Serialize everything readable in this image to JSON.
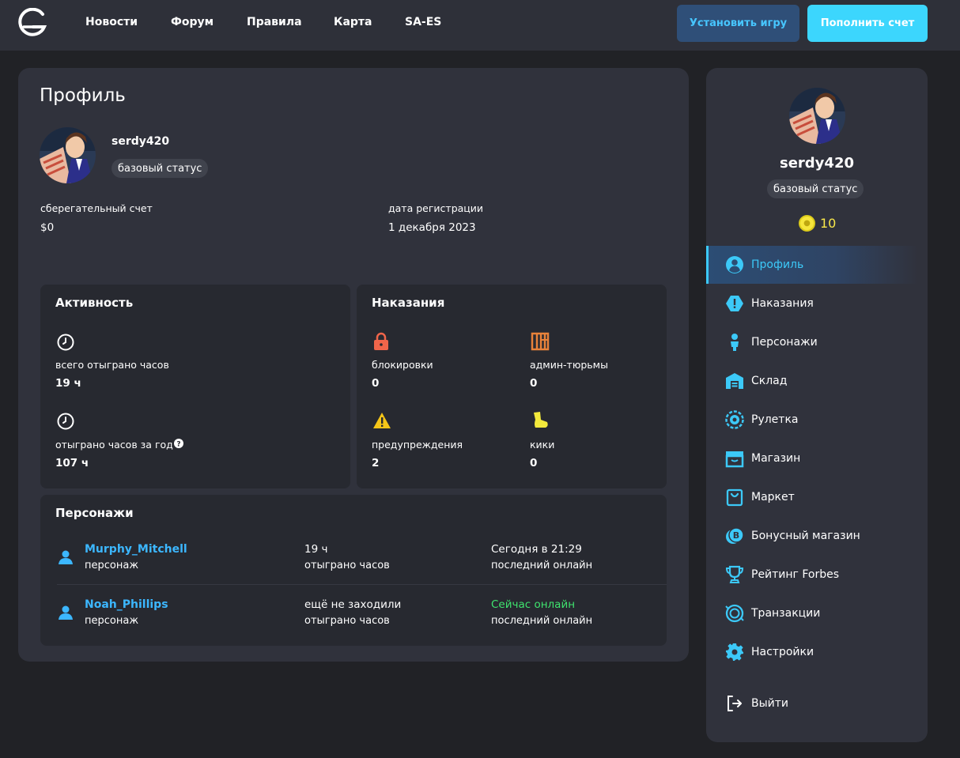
{
  "header": {
    "nav": [
      "Новости",
      "Форум",
      "Правила",
      "Карта",
      "SA-ES"
    ],
    "install_button": "Установить игру",
    "topup_button": "Пополнить счет"
  },
  "profile": {
    "title": "Профиль",
    "username": "serdy420",
    "status": "базовый статус",
    "savings_label": "сберегательный счет",
    "savings_value": "$0",
    "reg_label": "дата регистрации",
    "reg_value": "1 декабря 2023"
  },
  "activity": {
    "title": "Активность",
    "total_label": "всего отыграно часов",
    "total_value": "19 ч",
    "year_label": "отыграно часов за год",
    "year_value": "107 ч"
  },
  "punishments": {
    "title": "Наказания",
    "bans_label": "блокировки",
    "bans_value": "0",
    "jail_label": "админ-тюрьмы",
    "jail_value": "0",
    "warns_label": "предупреждения",
    "warns_value": "2",
    "kicks_label": "кики",
    "kicks_value": "0"
  },
  "characters": {
    "title": "Персонажи",
    "items": [
      {
        "name": "Murphy_Mitchell",
        "type": "персонаж",
        "hours": "19 ч",
        "hours_label": "отыграно часов",
        "last_online": "Сегодня в 21:29",
        "last_online_label": "последний онлайн"
      },
      {
        "name": "Noah_Phillips",
        "type": "персонаж",
        "hours": "ещё не заходили",
        "hours_label": "отыграно часов",
        "last_online": "Сейчас онлайн",
        "last_online_label": "последний онлайн"
      }
    ]
  },
  "sidebar": {
    "username": "serdy420",
    "status": "базовый статус",
    "coins": "10",
    "menu": [
      {
        "label": "Профиль",
        "icon": "user-circle-icon"
      },
      {
        "label": "Наказания",
        "icon": "alert-hexagon-icon"
      },
      {
        "label": "Персонажи",
        "icon": "person-icon"
      },
      {
        "label": "Склад",
        "icon": "warehouse-icon"
      },
      {
        "label": "Рулетка",
        "icon": "roulette-icon"
      },
      {
        "label": "Магазин",
        "icon": "store-icon"
      },
      {
        "label": "Маркет",
        "icon": "bag-icon"
      },
      {
        "label": "Бонусный магазин",
        "icon": "bonus-coin-icon"
      },
      {
        "label": "Рейтинг Forbes",
        "icon": "trophy-icon"
      },
      {
        "label": "Транзакции",
        "icon": "transactions-icon"
      },
      {
        "label": "Настройки",
        "icon": "gear-icon"
      },
      {
        "label": "Выйти",
        "icon": "logout-icon"
      }
    ]
  },
  "colors": {
    "accent": "#3cc9f8",
    "link": "#3cb7ff",
    "online": "#3fe36e",
    "danger": "#f0654a",
    "warning": "#f5c518",
    "jail": "#e8823a",
    "kick": "#f3e93c"
  }
}
